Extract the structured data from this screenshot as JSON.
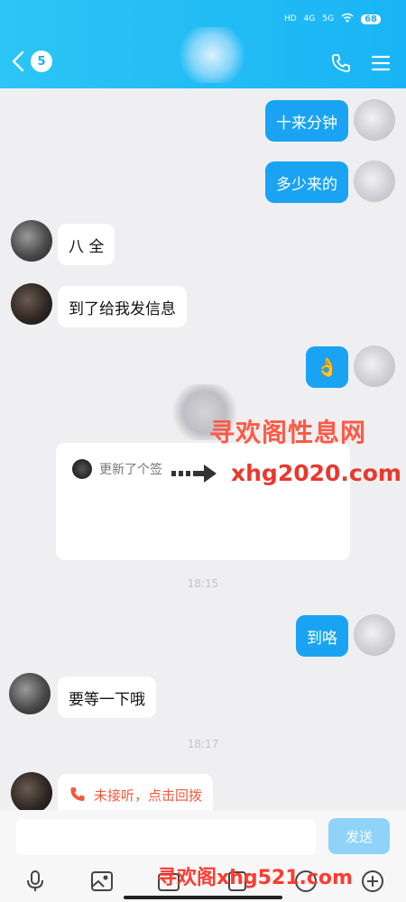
{
  "status_bar": {
    "network_hd": "HD",
    "network_4g": "4G",
    "network_5g": "5G",
    "battery": "68"
  },
  "header": {
    "unread_count": "5"
  },
  "messages": [
    {
      "side": "out",
      "text": "十来分钟"
    },
    {
      "side": "out",
      "text": "多少来的"
    },
    {
      "side": "in",
      "text": "八  全"
    },
    {
      "side": "in",
      "text": "到了给我发信息"
    },
    {
      "side": "out",
      "text": "👌"
    },
    {
      "side": "out",
      "text": "到咯"
    },
    {
      "side": "in",
      "text": "要等一下哦"
    }
  ],
  "card": {
    "text": "更新了个签"
  },
  "timestamps": [
    "18:15",
    "18:17"
  ],
  "missed_call": {
    "text": "未接听，点击回拨"
  },
  "watermark": {
    "top": "寻欢阁性息网",
    "url": "xhg2020.com",
    "bottom": "寻欢阁xhg521.com"
  },
  "input": {
    "placeholder": "",
    "send_label": "发送"
  },
  "colors": {
    "header": "#19b4f5",
    "outgoing_bubble": "#1aa3f2",
    "missed_call": "#f25a3a",
    "send_button": "#8fd3f9"
  }
}
